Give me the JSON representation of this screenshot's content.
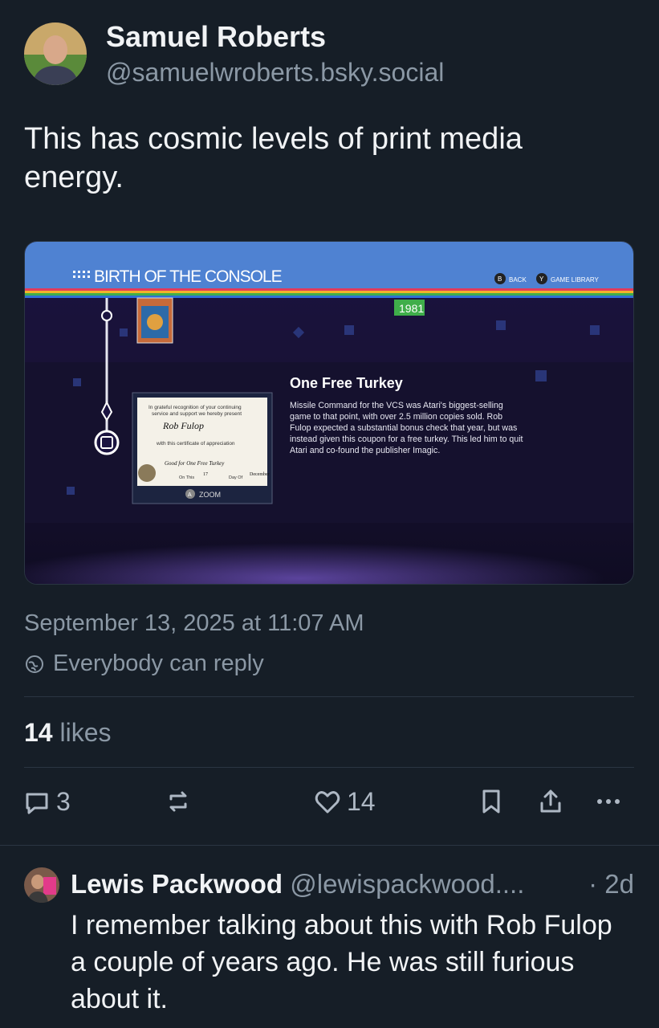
{
  "post": {
    "author_name": "Samuel Roberts",
    "author_handle": "@samuelwroberts.bsky.social",
    "text": "This has cosmic levels of print media energy.",
    "date": "September 13, 2025 at 11:07 AM",
    "reply_setting": "Everybody can reply",
    "likes_count": "14",
    "likes_label": "likes"
  },
  "embed": {
    "header_title": "BIRTH OF THE CONSOLE",
    "btn_back_key": "B",
    "btn_back_label": "BACK",
    "btn_library_key": "Y",
    "btn_library_label": "GAME LIBRARY",
    "year": "1981",
    "card_title": "One Free Turkey",
    "card_body_lines": [
      "Missile Command for the VCS was Atari's biggest-selling",
      "game to that point, with over 2.5 million copies sold. Rob",
      "Fulop expected a substantial bonus check that year, but was",
      "instead given this coupon for a free turkey. This led him to quit",
      "Atari and co-found the publisher Imagic."
    ],
    "cert_line1": "In grateful recognition of your continuing",
    "cert_line2": "service and support we hereby present",
    "cert_name": "Rob Fulop",
    "cert_line3": "with this certificate of appreciation",
    "cert_offer": "Good for One Free Turkey",
    "cert_on_this": "On This",
    "cert_day_num": "17",
    "cert_day_of": "Day Of",
    "cert_month": "December",
    "zoom_key": "A",
    "zoom_label": "ZOOM"
  },
  "actions": {
    "reply_count": "3",
    "like_count": "14"
  },
  "reply": {
    "author_name": "Lewis Packwood",
    "author_handle": "@lewispackwood....",
    "time": "· 2d",
    "text": "I remember talking about this with Rob Fulop a couple of years ago. He was still furious about it."
  },
  "colors": {
    "background": "#161e27",
    "muted_text": "#8b98a5",
    "header_blue": "#4f82d2",
    "year_green": "#3fae4a"
  }
}
